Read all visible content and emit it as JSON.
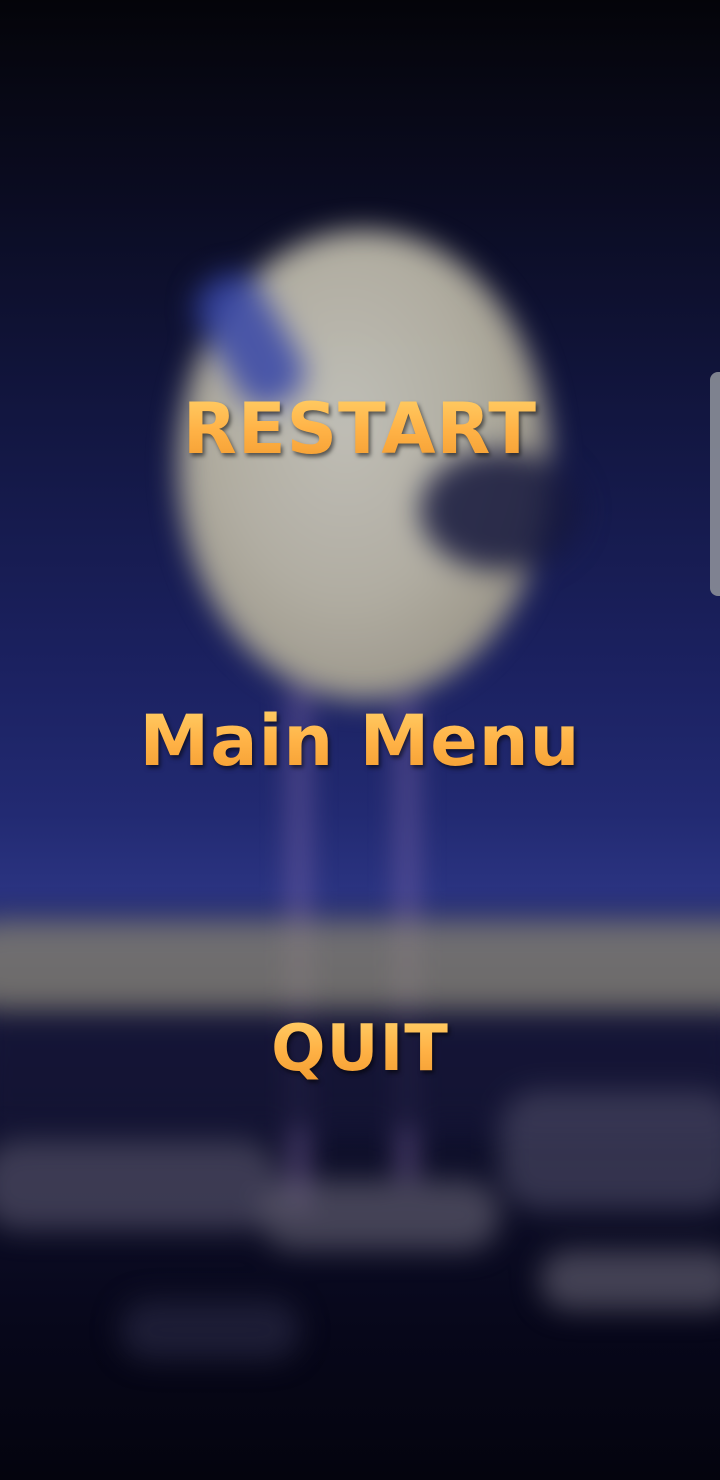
{
  "menu": {
    "restart_label": "RESTART",
    "main_menu_label": "Main Menu",
    "quit_label": "QUIT"
  },
  "colors": {
    "menu_text": "#ffb347",
    "background_top": "#040409",
    "background_mid": "#222a72",
    "moon": "#b9b5a6"
  },
  "icons": {
    "edge_panel_handle": "edge-panel-handle"
  }
}
